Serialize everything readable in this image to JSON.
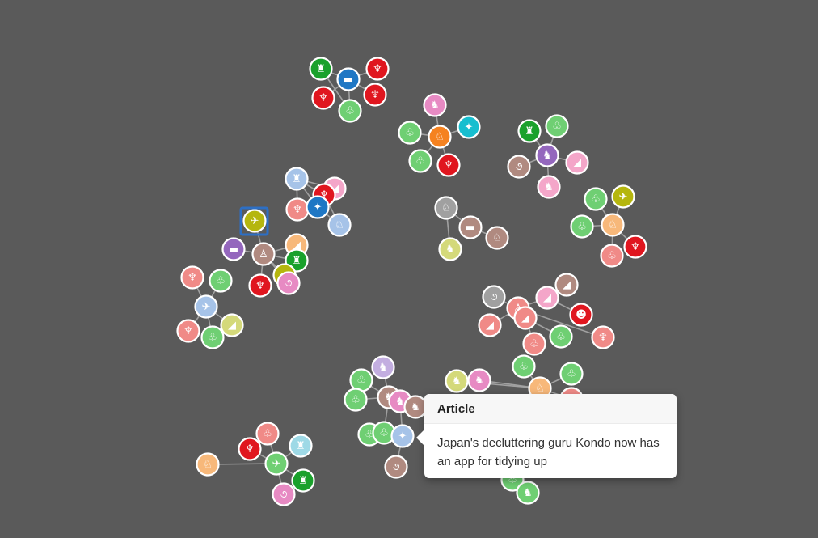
{
  "colors": {
    "background": "#5a5a5a",
    "edge": "#a8a8a8",
    "selection": "#2d6fc4",
    "node_palette": {
      "red": "#e0161f",
      "green": "#1aa12c",
      "lightgreen": "#6fcf73",
      "blue": "#1f77c4",
      "lightblue": "#a6c3e8",
      "orange": "#f58220",
      "lightorange": "#f7b87a",
      "pink": "#e78ac3",
      "lightpink": "#f4a6c9",
      "salmon": "#f08a87",
      "purple": "#9467bd",
      "lavender": "#c3aee0",
      "olive": "#b5b60e",
      "lightolive": "#d4d97a",
      "gray": "#a0a0a0",
      "brown": "#b08a80",
      "teal": "#17becf",
      "lightteal": "#9ed9e6"
    }
  },
  "icon_glyphs": {
    "bat-icon": "♆",
    "leaf-icon": "♧",
    "tank-icon": "▬",
    "vehicle-icon": "♜",
    "cat-icon": "♞",
    "plane-icon": "✈",
    "bird-icon": "✦",
    "animal-icon": "♘",
    "fish-icon": "◢",
    "monkey-icon": "☻",
    "person-icon": "♙",
    "swirl-icon": "૭"
  },
  "popover": {
    "title": "Article",
    "content": "Japan's decluttering guru Kondo now has an app for tidying up"
  }
}
